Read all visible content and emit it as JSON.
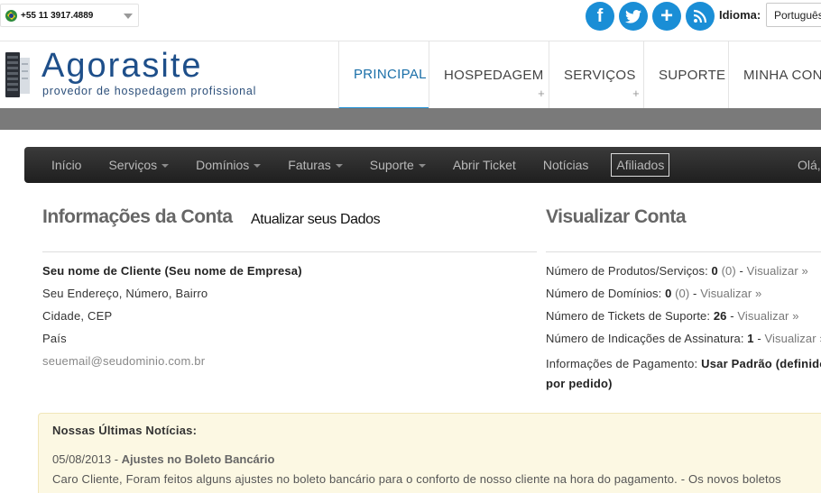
{
  "topbar": {
    "phone": "+55 11 3917.4889",
    "social_icons": [
      "facebook-icon",
      "twitter-icon",
      "plus-icon",
      "rss-icon"
    ],
    "language_label": "Idioma:",
    "language_value": "Português"
  },
  "header": {
    "logo_name_part1": "Agora",
    "logo_name_part2": "site",
    "logo_tagline": "provedor de hospedagem profissional",
    "nav": [
      {
        "label": "PRINCIPAL",
        "active": true
      },
      {
        "label": "HOSPEDAGEM",
        "plus": "+"
      },
      {
        "label": "SERVIÇOS",
        "plus": "+"
      },
      {
        "label": "SUPORTE"
      },
      {
        "label": "MINHA CONTA"
      }
    ]
  },
  "menu": {
    "items": [
      "Início",
      "Serviços",
      "Domínios",
      "Faturas",
      "Suporte",
      "Abrir Ticket",
      "Notícias",
      "Afiliados"
    ],
    "user_greeting": "Olá,"
  },
  "account": {
    "title": "Informações da Conta",
    "update_link": "Atualizar seus Dados",
    "name": "Seu nome de Cliente (Seu nome de Empresa)",
    "address": "Seu Endereço, Número, Bairro",
    "city": "Cidade, CEP",
    "country": "País",
    "email": "seuemail@seudominio.com.br"
  },
  "view_account": {
    "title": "Visualizar Conta",
    "stats": [
      {
        "label": "Número de Produtos/Serviços:",
        "value": "0",
        "paren": "(0)",
        "link": "Visualizar »"
      },
      {
        "label": "Número de Domínios:",
        "value": "0",
        "paren": "(0)",
        "link": "Visualizar »"
      },
      {
        "label": "Número de Tickets de Suporte:",
        "value": "26",
        "paren": "",
        "link": "Visualizar »"
      },
      {
        "label": "Número de Indicações de Assinatura:",
        "value": "1",
        "paren": "",
        "link": "Visualizar »"
      }
    ],
    "payment_label": "Informações de Pagamento:",
    "payment_value": "Usar Padrão (definido por pedido)"
  },
  "news": {
    "title": "Nossas Últimas Notícias:",
    "date": "05/08/2013",
    "headline": "Ajustes no Boleto Bancário",
    "body": "Caro Cliente, Foram feitos alguns ajustes no boleto bancário para o conforto de nosso cliente na hora do pagamento. - Os novos boletos"
  },
  "colors": {
    "social": "#1a8ed6",
    "logo": "#1e4f8a",
    "nav_active": "#1a6fa8",
    "menu_bg": "#2a2a2a",
    "news_bg": "#fcf8e3"
  }
}
